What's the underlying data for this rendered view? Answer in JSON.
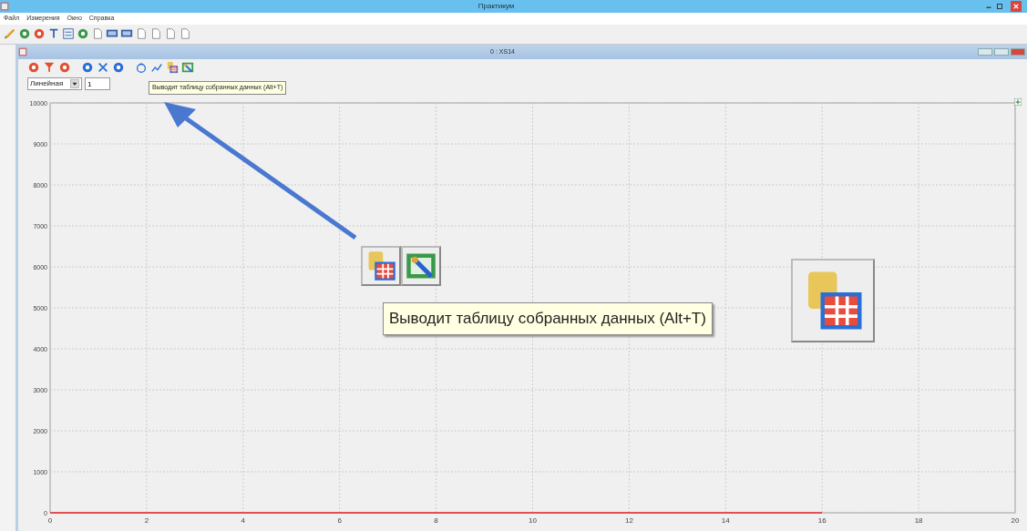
{
  "window": {
    "title": "Практикум"
  },
  "menu": [
    "Файл",
    "Измерения",
    "Окно",
    "Справка"
  ],
  "child_window": {
    "title": "0 : XS14"
  },
  "scale_select": {
    "value": "Линейная"
  },
  "count_field": {
    "value": "1"
  },
  "tooltip": {
    "text": "Выводит таблицу собранных данных (Alt+T)"
  },
  "callout": {
    "tooltip": "Выводит таблицу собранных данных (Alt+T)"
  },
  "chart_data": {
    "type": "line",
    "x": [
      0,
      16
    ],
    "grid": true,
    "series": [
      {
        "color": "#e05050",
        "values": [
          0,
          0
        ]
      }
    ],
    "xlim": [
      0,
      20
    ],
    "ylim": [
      0,
      10000
    ],
    "xticks": [
      0,
      2,
      4,
      6,
      8,
      10,
      12,
      14,
      16,
      18,
      20
    ],
    "yticks": [
      0,
      1000,
      2000,
      3000,
      4000,
      5000,
      6000,
      7000,
      8000,
      9000,
      10000
    ]
  }
}
